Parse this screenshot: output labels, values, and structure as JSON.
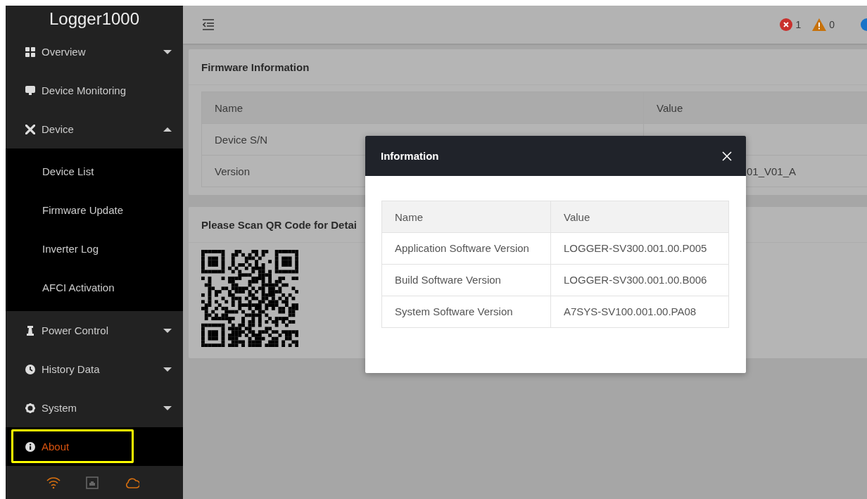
{
  "sidebar": {
    "title": "Logger1000",
    "items": [
      {
        "label": "Overview",
        "selected": false,
        "expanded": false
      },
      {
        "label": "Device Monitoring",
        "selected": false
      },
      {
        "label": "Device",
        "selected": false,
        "expanded": true,
        "children": [
          {
            "label": "Device List",
            "selected": false
          },
          {
            "label": "Firmware Update",
            "selected": false
          },
          {
            "label": "Inverter Log",
            "selected": false
          },
          {
            "label": "AFCI Activation",
            "selected": false
          }
        ]
      },
      {
        "label": "Power Control",
        "selected": false,
        "expanded": false
      },
      {
        "label": "History Data",
        "selected": false,
        "expanded": false
      },
      {
        "label": "System",
        "selected": false,
        "expanded": false
      },
      {
        "label": "About",
        "selected": true,
        "highlighted": true
      }
    ],
    "status_icons": [
      {
        "connected": true
      },
      {
        "connected": false
      },
      {
        "connected": true
      }
    ]
  },
  "header": {
    "alarms": [
      {
        "kind": "error",
        "count": "1"
      },
      {
        "kind": "warning",
        "count": "0"
      }
    ]
  },
  "firmware_card": {
    "title": "Firmware Information",
    "columns": [
      "Name",
      "Value"
    ],
    "rows": [
      {
        "name": "Device S/N"
      },
      {
        "name": "Version",
        "value": "01_V01_A"
      }
    ]
  },
  "qr_card": {
    "title": "Please Scan QR Code for Detai"
  },
  "modal": {
    "title": "Information",
    "columns": [
      "Name",
      "Value"
    ],
    "rows": [
      {
        "name": "Application Software Version",
        "value": "LOGGER-SV300.001.00.P005"
      },
      {
        "name": "Build Software Version",
        "value": "LOGGER-SV300.001.00.B006"
      },
      {
        "name": "System Software Version",
        "value": "A7SYS-SV100.001.00.PA08"
      }
    ]
  }
}
